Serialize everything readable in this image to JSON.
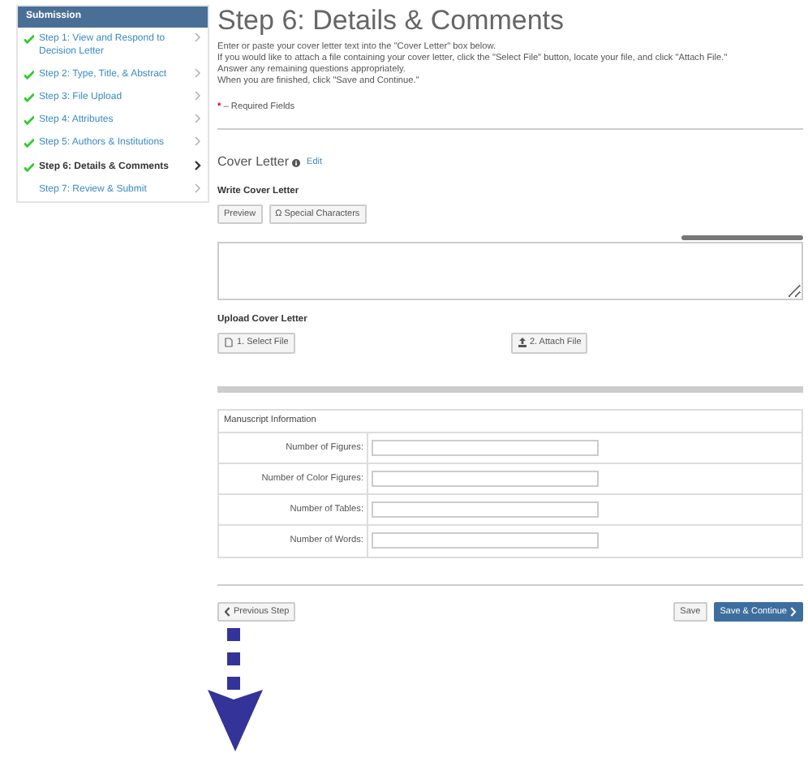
{
  "sidebar": {
    "title": "Submission",
    "items": [
      {
        "label": "Step 1: View and Respond to Decision Letter",
        "completed": true,
        "selected": false
      },
      {
        "label": "Step 2: Type, Title, & Abstract",
        "completed": true,
        "selected": false
      },
      {
        "label": "Step 3: File Upload",
        "completed": true,
        "selected": false
      },
      {
        "label": "Step 4: Attributes",
        "completed": true,
        "selected": false
      },
      {
        "label": "Step 5: Authors & Institutions",
        "completed": true,
        "selected": false
      },
      {
        "label": "Step 6: Details & Comments",
        "completed": true,
        "selected": true
      },
      {
        "label": "Step 7: Review & Submit",
        "completed": false,
        "selected": false
      }
    ]
  },
  "page": {
    "title": "Step 6: Details & Comments",
    "instructions": [
      "Enter or paste your cover letter text into the \"Cover Letter\" box below.",
      "If you would like to attach a file containing your cover letter, click the \"Select File\" button, locate your file, and click \"Attach File.\"",
      "Answer any remaining questions appropriately.",
      "When you are finished, click \"Save and Continue.\""
    ],
    "required_mark": "*",
    "required_note": "– Required Fields"
  },
  "cover_letter": {
    "heading": "Cover Letter",
    "edit_link": "Edit",
    "write_label": "Write Cover Letter",
    "toolbar": [
      "Preview",
      "Ω Special Characters"
    ],
    "upload_label": "Upload Cover Letter",
    "upload_buttons": [
      {
        "kind": "select",
        "label": "1. Select File"
      },
      {
        "kind": "attach",
        "label": "2. Attach File"
      }
    ]
  },
  "manuscript_info": {
    "heading": "Manuscript Information",
    "fields": [
      "Number of Figures:",
      "Number of Color Figures:",
      "Number of Tables:",
      "Number of Words:"
    ]
  },
  "footer": {
    "previous": "Previous Step",
    "save": "Save",
    "save_continue": "Save & Continue"
  }
}
